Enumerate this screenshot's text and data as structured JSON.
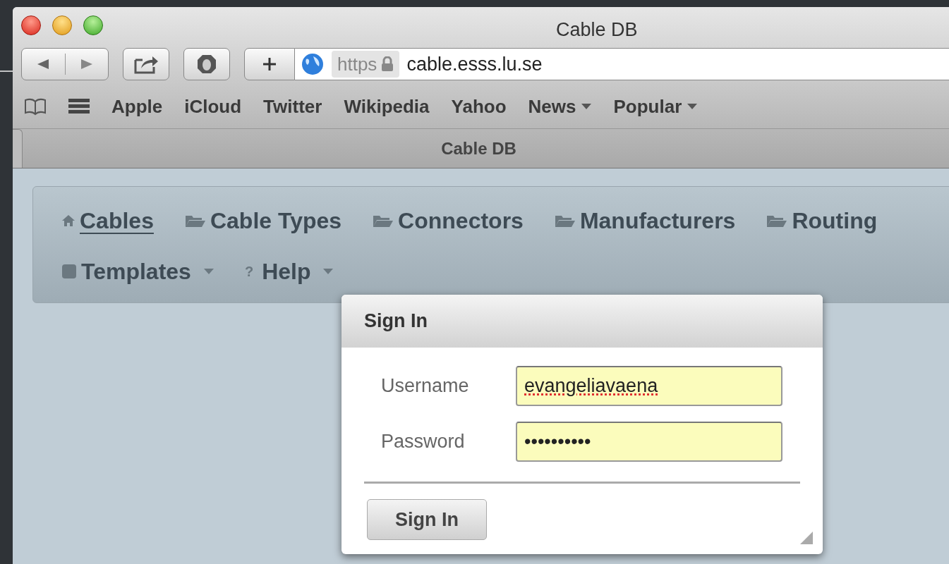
{
  "window": {
    "title": "Cable DB"
  },
  "toolbar": {
    "url_scheme": "https",
    "url": "cable.esss.lu.se"
  },
  "bookmarks": [
    {
      "label": "Apple",
      "menu": false
    },
    {
      "label": "iCloud",
      "menu": false
    },
    {
      "label": "Twitter",
      "menu": false
    },
    {
      "label": "Wikipedia",
      "menu": false
    },
    {
      "label": "Yahoo",
      "menu": false
    },
    {
      "label": "News",
      "menu": true
    },
    {
      "label": "Popular",
      "menu": true
    }
  ],
  "tab": {
    "title": "Cable DB"
  },
  "nav": [
    [
      {
        "label": "Cables",
        "kind": "home",
        "selected": true,
        "menu": false
      },
      {
        "label": "Cable Types",
        "kind": "folder",
        "selected": false,
        "menu": false
      },
      {
        "label": "Connectors",
        "kind": "folder",
        "selected": false,
        "menu": false
      },
      {
        "label": "Manufacturers",
        "kind": "folder",
        "selected": false,
        "menu": false
      },
      {
        "label": "Routing",
        "kind": "folder",
        "selected": false,
        "menu": false
      }
    ],
    [
      {
        "label": "Templates",
        "kind": "database",
        "selected": false,
        "menu": true
      },
      {
        "label": "Help",
        "kind": "glyph",
        "glyph": "?",
        "selected": false,
        "menu": true
      }
    ]
  ],
  "dialog": {
    "title": "Sign In",
    "fields": [
      {
        "label": "Username",
        "value": "evangeliavaena",
        "misspelled": true
      },
      {
        "label": "Password",
        "value": "••••••••••",
        "misspelled": false
      }
    ],
    "button": "Sign In"
  }
}
